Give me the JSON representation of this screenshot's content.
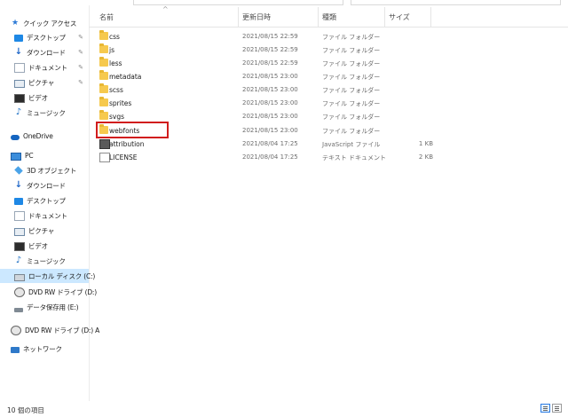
{
  "sidebar": {
    "items": [
      {
        "label": "クイック アクセス",
        "icon": "star-icon",
        "pinned": false
      },
      {
        "label": "デスクトップ",
        "icon": "desktop-icon",
        "pinned": true
      },
      {
        "label": "ダウンロード",
        "icon": "download-icon",
        "pinned": true
      },
      {
        "label": "ドキュメント",
        "icon": "document-icon",
        "pinned": true
      },
      {
        "label": "ピクチャ",
        "icon": "picture-icon",
        "pinned": true
      },
      {
        "label": "ビデオ",
        "icon": "video-icon",
        "pinned": false
      },
      {
        "label": "ミュージック",
        "icon": "music-icon",
        "pinned": false
      },
      {
        "label": "OneDrive",
        "icon": "onedrive-icon",
        "pinned": false
      },
      {
        "label": "PC",
        "icon": "pc-icon",
        "pinned": false
      },
      {
        "label": "3D オブジェクト",
        "icon": "3d-objects-icon",
        "pinned": false
      },
      {
        "label": "ダウンロード",
        "icon": "download-icon",
        "pinned": false
      },
      {
        "label": "デスクトップ",
        "icon": "desktop-icon",
        "pinned": false
      },
      {
        "label": "ドキュメント",
        "icon": "document-icon",
        "pinned": false
      },
      {
        "label": "ピクチャ",
        "icon": "picture-icon",
        "pinned": false
      },
      {
        "label": "ビデオ",
        "icon": "video-icon",
        "pinned": false
      },
      {
        "label": "ミュージック",
        "icon": "music-icon",
        "pinned": false
      },
      {
        "label": "ローカル ディスク (C:)",
        "icon": "local-disk-icon",
        "pinned": false,
        "selected": true
      },
      {
        "label": "DVD RW ドライブ (D:)",
        "icon": "dvd-drive-icon",
        "pinned": false
      },
      {
        "label": "データ保存用 (E:)",
        "icon": "usb-drive-icon",
        "pinned": false
      },
      {
        "label": "DVD RW ドライブ (D:) A",
        "icon": "dvd-drive-icon",
        "pinned": false
      },
      {
        "label": "ネットワーク",
        "icon": "network-icon",
        "pinned": false
      }
    ],
    "pin_glyph": "✎"
  },
  "columns": {
    "name": "名前",
    "date": "更新日時",
    "type": "種類",
    "size": "サイズ",
    "sort_arrow": "^"
  },
  "files": [
    {
      "name": "css",
      "date": "2021/08/15 22:59",
      "type": "ファイル フォルダー",
      "size": "",
      "kind": "folder"
    },
    {
      "name": "js",
      "date": "2021/08/15 22:59",
      "type": "ファイル フォルダー",
      "size": "",
      "kind": "folder"
    },
    {
      "name": "less",
      "date": "2021/08/15 22:59",
      "type": "ファイル フォルダー",
      "size": "",
      "kind": "folder"
    },
    {
      "name": "metadata",
      "date": "2021/08/15 23:00",
      "type": "ファイル フォルダー",
      "size": "",
      "kind": "folder"
    },
    {
      "name": "scss",
      "date": "2021/08/15 23:00",
      "type": "ファイル フォルダー",
      "size": "",
      "kind": "folder"
    },
    {
      "name": "sprites",
      "date": "2021/08/15 23:00",
      "type": "ファイル フォルダー",
      "size": "",
      "kind": "folder"
    },
    {
      "name": "svgs",
      "date": "2021/08/15 23:00",
      "type": "ファイル フォルダー",
      "size": "",
      "kind": "folder"
    },
    {
      "name": "webfonts",
      "date": "2021/08/15 23:00",
      "type": "ファイル フォルダー",
      "size": "",
      "kind": "folder"
    },
    {
      "name": "attribution",
      "date": "2021/08/04 17:25",
      "type": "JavaScript ファイル",
      "size": "1 KB",
      "kind": "js"
    },
    {
      "name": "LICENSE",
      "date": "2021/08/04 17:25",
      "type": "テキスト ドキュメント",
      "size": "2 KB",
      "kind": "text"
    }
  ],
  "status": {
    "item_count": "10 個の項目"
  },
  "colors": {
    "highlight": "#d11d1d",
    "selected_bg": "#cce8ff",
    "folder": "#f6c94e"
  }
}
